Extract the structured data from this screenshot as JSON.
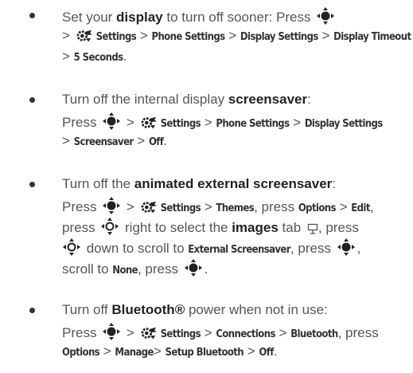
{
  "items": [
    {
      "lines": [
        [
          "Set your ",
          "display",
          " to turn off sooner: Press "
        ],
        [
          ">",
          " ",
          "Settings",
          " > ",
          "Phone Settings",
          " > ",
          "Display Settings",
          " > ",
          "Display Timeout"
        ],
        [
          ">",
          " ",
          "5 Seconds",
          "."
        ]
      ]
    },
    {
      "lines": [
        [
          "Turn off the internal display ",
          "screensaver",
          ":"
        ],
        [
          "Press ",
          " > ",
          " ",
          "Settings",
          " > ",
          "Phone Settings",
          " > ",
          "Display Settings"
        ],
        [
          ">",
          " ",
          "Screensaver",
          " > ",
          "Off",
          "."
        ]
      ]
    },
    {
      "lines": [
        [
          "Turn off the ",
          "animated external screensaver",
          ":"
        ],
        [
          "Press ",
          " > ",
          " ",
          "Settings",
          " > ",
          "Themes",
          ", press ",
          "Options",
          " > ",
          "Edit",
          ","
        ],
        [
          "press ",
          " right to select the ",
          "images",
          " tab ",
          ", press"
        ],
        [
          "",
          " down to scroll to ",
          "External Screensaver",
          ", press ",
          ","
        ],
        [
          "scroll to ",
          "None",
          ", press ",
          "."
        ]
      ]
    },
    {
      "lines": [
        [
          "Turn off ",
          "Bluetooth®",
          " power when not in use:"
        ],
        [
          "Press ",
          " > ",
          " ",
          "Settings",
          " > ",
          "Connections",
          " > ",
          "Bluetooth",
          ", press"
        ],
        [
          "Options",
          " > ",
          "Manage",
          "> ",
          "Setup Bluetooth",
          " > ",
          "Off",
          "."
        ]
      ]
    }
  ]
}
